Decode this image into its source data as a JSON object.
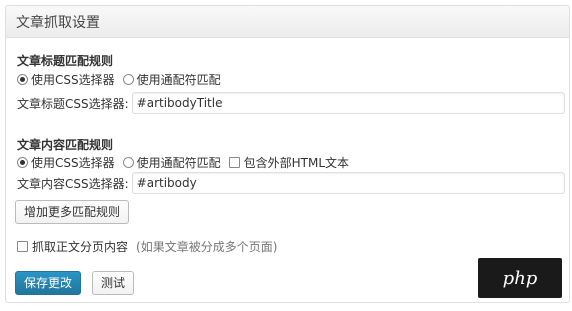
{
  "panel": {
    "title": "文章抓取设置"
  },
  "title_rule": {
    "heading": "文章标题匹配规则",
    "option_css": "使用CSS选择器",
    "option_wildcard": "使用通配符匹配",
    "field_label": "文章标题CSS选择器:",
    "field_value": "#artibodyTitle"
  },
  "content_rule": {
    "heading": "文章内容匹配规则",
    "option_css": "使用CSS选择器",
    "option_wildcard": "使用通配符匹配",
    "include_outer_html": "包含外部HTML文本",
    "field_label": "文章内容CSS选择器:",
    "field_value": "#artibody"
  },
  "add_rules_button": "增加更多匹配规则",
  "paging": {
    "label": "抓取正文分页内容",
    "hint": "(如果文章被分成多个页面)"
  },
  "buttons": {
    "save": "保存更改",
    "test": "测试"
  },
  "watermark": {
    "text": "php"
  }
}
